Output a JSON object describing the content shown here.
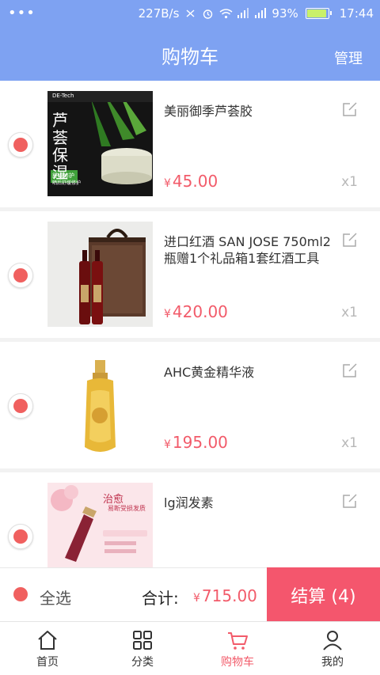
{
  "status_bar": {
    "left": "•••",
    "speed": "227B/s",
    "battery_pct": "93%",
    "time": "17:44"
  },
  "header": {
    "title": "购物车",
    "manage": "管理"
  },
  "currency_symbol": "¥",
  "items": [
    {
      "name": "美丽御季芦荟胶",
      "price": "45.00",
      "qty": "x1"
    },
    {
      "name": "进口红酒 SAN JOSE 750ml2瓶赠1个礼品箱1套红酒工具",
      "price": "420.00",
      "qty": "x1"
    },
    {
      "name": "AHC黄金精华液",
      "price": "195.00",
      "qty": "x1"
    },
    {
      "name": "lg润发素",
      "price": "",
      "qty": ""
    }
  ],
  "product_image_text": {
    "aloe_brand": "DE-Tech",
    "aloe_headline": "芦荟保湿",
    "aloe_badge": "舒缓修护",
    "aloe_sub": "晒后舒缓修护",
    "hair_title": "治愈",
    "hair_sub": "易断受损发质"
  },
  "actionbar": {
    "select_all": "全选",
    "total_label": "合计:",
    "total_value": "715.00",
    "checkout": "结算 (4)"
  },
  "tabs": [
    {
      "label": "首页",
      "icon": "home-icon"
    },
    {
      "label": "分类",
      "icon": "grid-icon"
    },
    {
      "label": "购物车",
      "icon": "cart-icon",
      "active": true
    },
    {
      "label": "我的",
      "icon": "user-icon"
    }
  ],
  "colors": {
    "header": "#7ea2f2",
    "accent": "#f25b6a",
    "checkout": "#f4566d"
  }
}
